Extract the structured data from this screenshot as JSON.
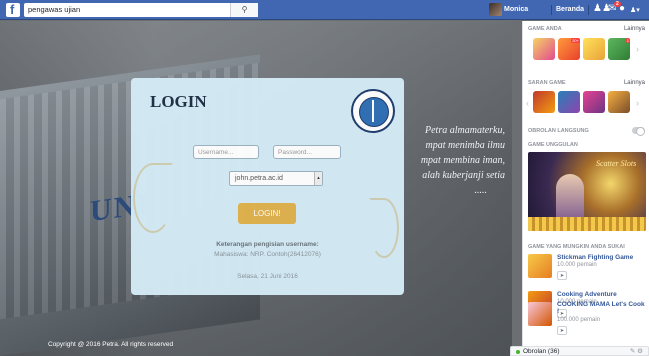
{
  "topbar": {
    "search_value": "pengawas ujian",
    "search_button_icon": "search-icon",
    "user_name": "Monica",
    "home_label": "Beranda",
    "notification_count": "2",
    "brand_color": "#4267b2"
  },
  "page": {
    "poem_lines": [
      "Petra almamaterku,",
      "mpat menimba ilmu",
      "mpat membina iman,",
      "alah kuberjanji setia",
      "....."
    ],
    "wall_letters": "UNI",
    "copyright": "Copyright @ 2016 Petra. All rights reserved"
  },
  "login": {
    "title": "LOGIN",
    "username_placeholder": "Username...",
    "password_placeholder": "Password...",
    "domain_selected": "john.petra.ac.id",
    "submit_label": "LOGIN!",
    "note_heading": "Keterangan pengisian username:",
    "note_body": "Mahasiswa: NRP. Contoh(26412076)",
    "date": "Selasa, 21 Juni 2016",
    "seal_text": "UNIVERSITAS KRISTEN PETRA",
    "button_color": "#dfb24c",
    "card_color": "#d4ebf6"
  },
  "sidebar": {
    "game_anda": "GAME ANDA",
    "game_anda_more": "Lainnya",
    "game_anda_badges": [
      "",
      "20+",
      "",
      "1"
    ],
    "saran_game": "SARAN GAME",
    "saran_more": "Lainnya",
    "obrolan": "OBROLAN LANGSUNG",
    "unggulan": "GAME UNGGULAN",
    "banner_title": "Scatter Slots",
    "mungkin": "GAME YANG MUNGKIN ANDA SUKAI",
    "games": [
      {
        "name": "Stickman Fighting Game",
        "players": "10.000 pemain"
      },
      {
        "name": "Cooking Adventure",
        "players": "10.000 pemain"
      },
      {
        "name": "COOKING MAMA Let's Cook !",
        "players": "100.000 pemain"
      }
    ]
  },
  "chat": {
    "label": "Obrolan (36)"
  }
}
